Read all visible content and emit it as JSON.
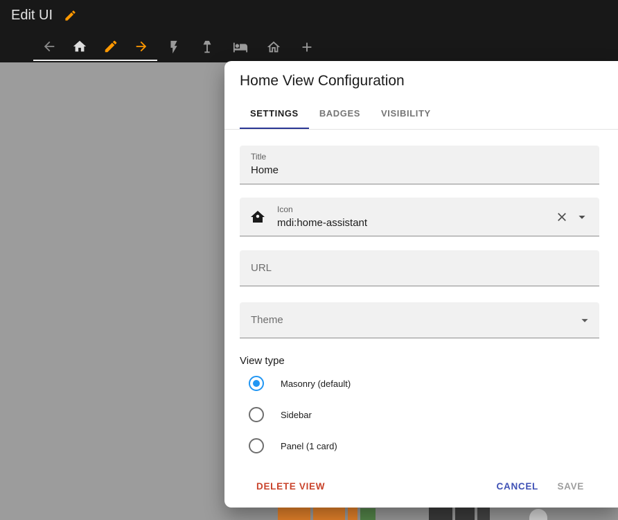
{
  "header": {
    "title": "Edit UI",
    "icons": {
      "title_edit": "pencil-icon",
      "move_view_left": "arrow-left-icon",
      "active_view": "home-icon",
      "edit_view": "pencil-icon",
      "move_view_right": "arrow-right-icon",
      "other_view_tabs": [
        "flash-icon",
        "floor-lamp-icon",
        "bed-icon",
        "home-outline-icon"
      ],
      "add_view": "plus-icon"
    }
  },
  "dialog": {
    "title": "Home View Configuration",
    "tabs": [
      {
        "label": "SETTINGS",
        "active": true
      },
      {
        "label": "BADGES",
        "active": false
      },
      {
        "label": "VISIBILITY",
        "active": false
      }
    ],
    "fields": {
      "title": {
        "label": "Title",
        "value": "Home"
      },
      "icon": {
        "label": "Icon",
        "value": "mdi:home-assistant",
        "leading_icon": "home-assistant-icon",
        "trailing_icons": [
          "clear-icon",
          "dropdown-caret-icon"
        ]
      },
      "url": {
        "label": "URL",
        "value": ""
      },
      "theme": {
        "label": "Theme",
        "value": "",
        "trailing_icon": "dropdown-caret-icon"
      }
    },
    "view_type": {
      "label": "View type",
      "options": [
        {
          "label": "Masonry (default)",
          "selected": true
        },
        {
          "label": "Sidebar",
          "selected": false
        },
        {
          "label": "Panel (1 card)",
          "selected": false
        }
      ]
    },
    "actions": {
      "delete": "DELETE VIEW",
      "cancel": "CANCEL",
      "save": "SAVE",
      "save_disabled": true
    }
  },
  "colors": {
    "header_bg": "#181818",
    "accent_orange": "#ff9800",
    "tab_indicator": "#283593",
    "radio_selected": "#2196f3",
    "delete_text": "#c9432b",
    "cancel_text": "#3f51b5",
    "save_disabled_text": "#9e9e9e",
    "scrim": "#9c9c9c"
  }
}
